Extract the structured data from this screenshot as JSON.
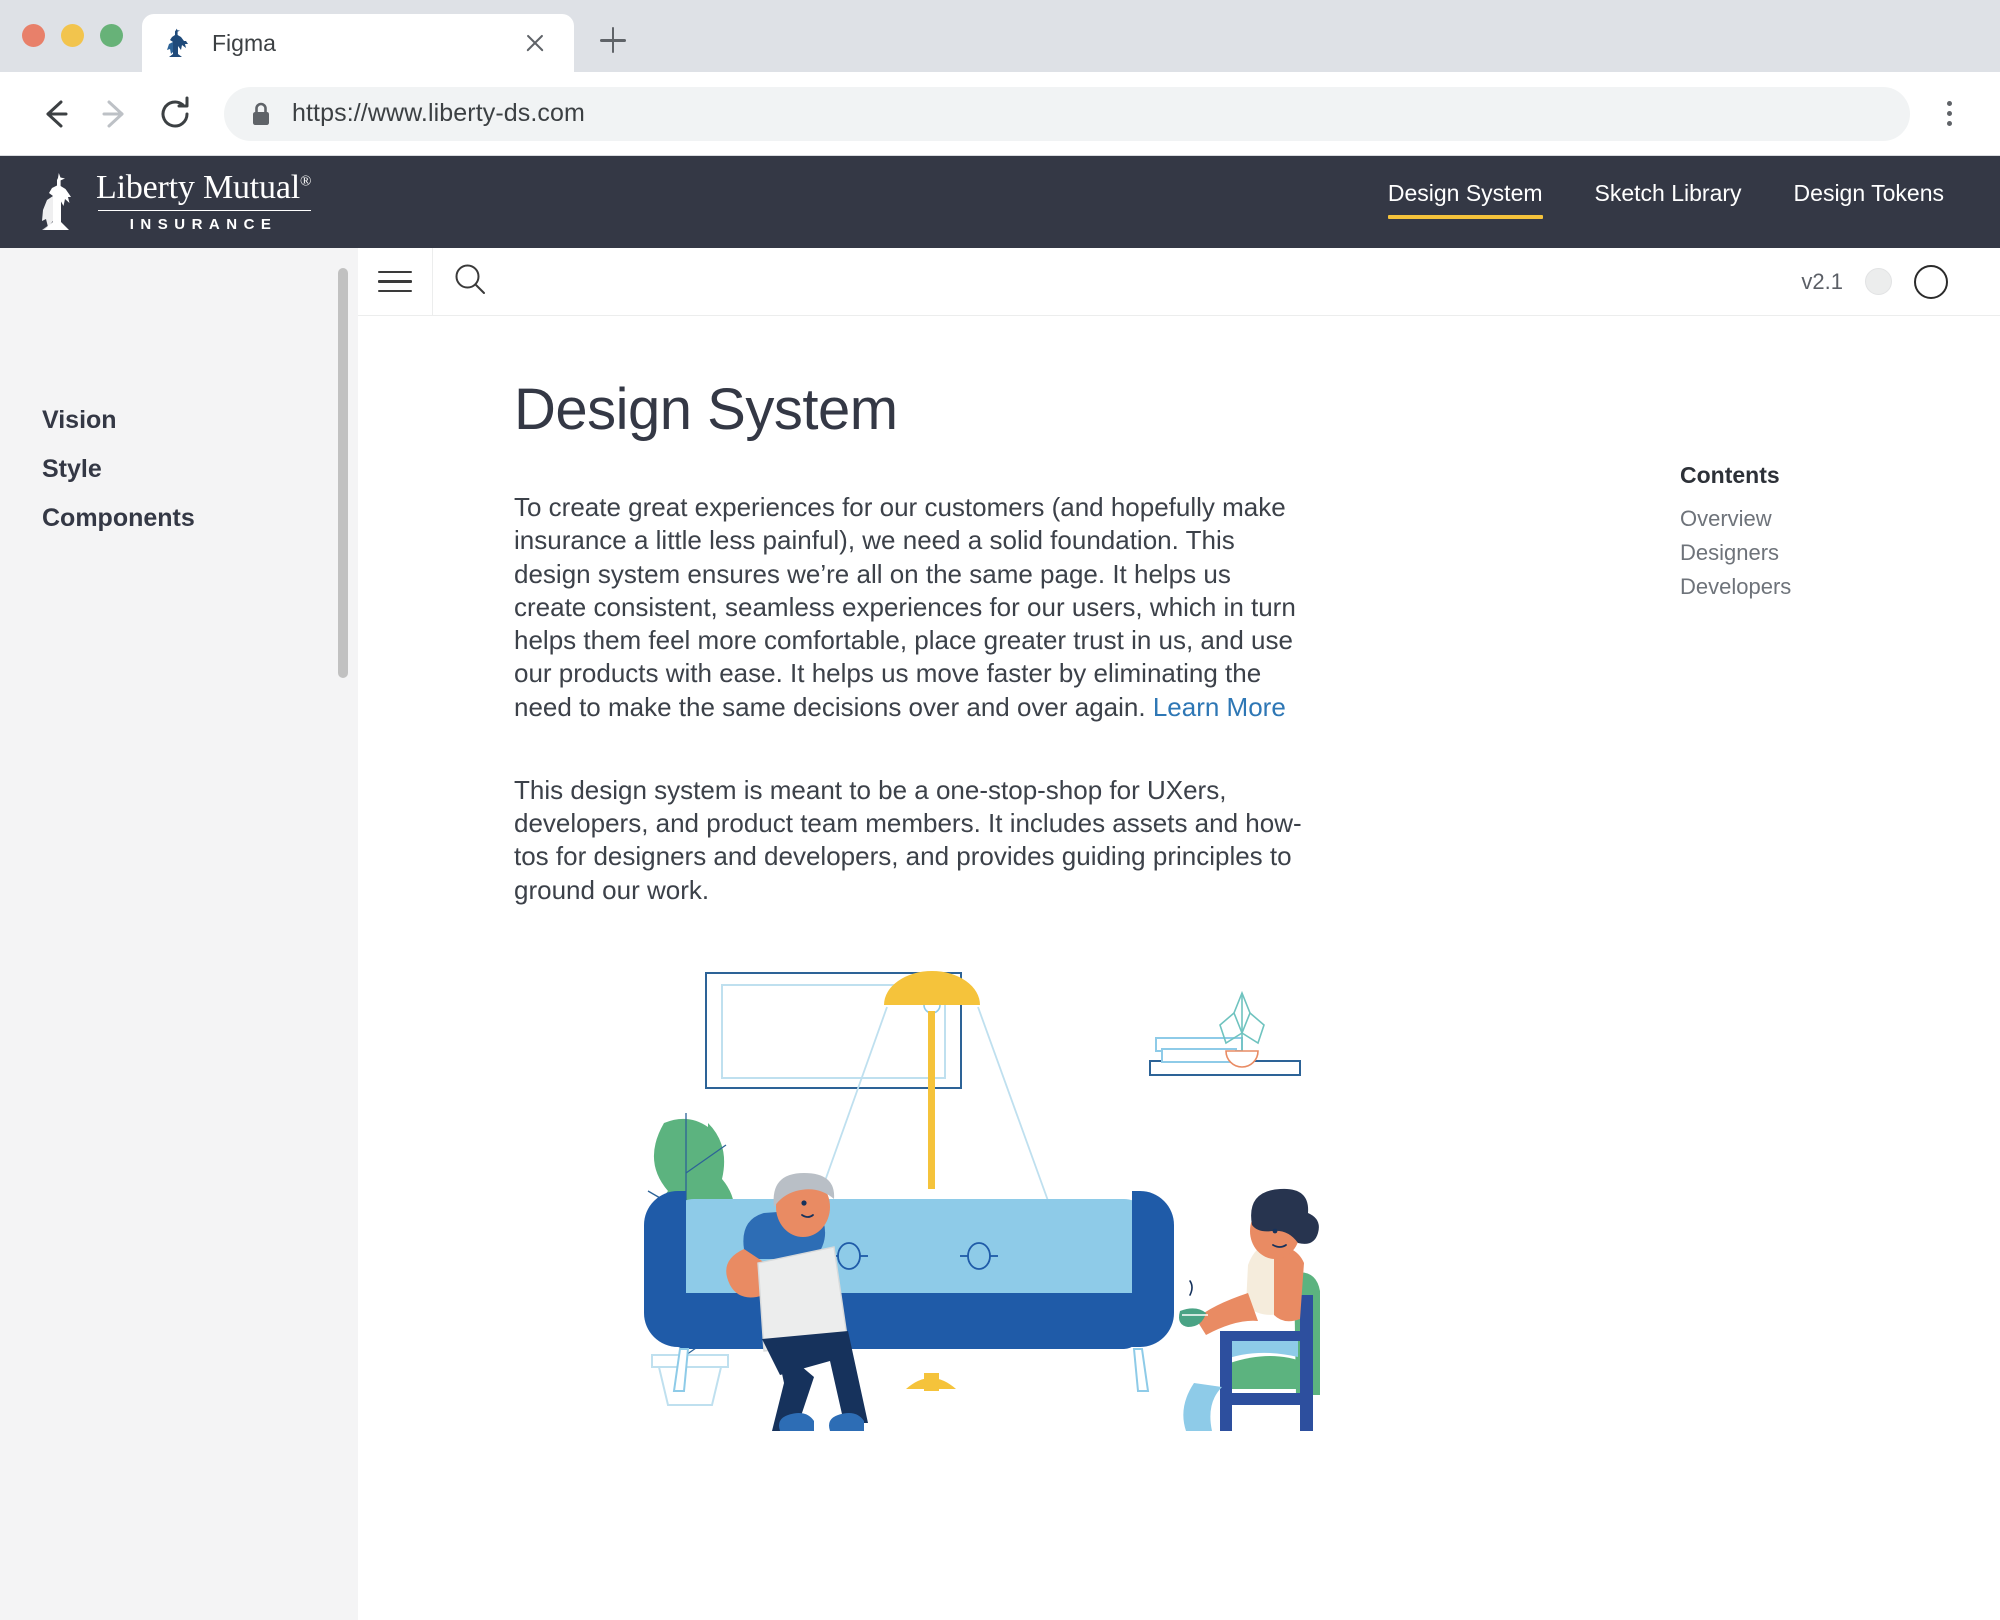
{
  "browser": {
    "tab": {
      "title": "Figma",
      "favicon_icon": "statue-of-liberty-icon",
      "close_icon": "close-icon"
    },
    "new_tab_icon": "plus-icon",
    "back_icon": "arrow-left-icon",
    "forward_icon": "arrow-right-icon",
    "reload_icon": "reload-icon",
    "lock_icon": "lock-icon",
    "url": "https://www.liberty-ds.com",
    "menu_icon": "kebab-menu-icon",
    "traffic_lights": [
      "close-window-button",
      "minimize-window-button",
      "maximize-window-button"
    ]
  },
  "site_header": {
    "logo": {
      "mark_icon": "statue-of-liberty-logo-icon",
      "wordmark": "Liberty Mutual",
      "registered": "®",
      "subtitle": "INSURANCE"
    },
    "nav": [
      {
        "label": "Design System",
        "active": true
      },
      {
        "label": "Sketch Library",
        "active": false
      },
      {
        "label": "Design Tokens",
        "active": false
      }
    ],
    "background_color": "#343845",
    "active_underline_color": "#f5c33b"
  },
  "sidebar": {
    "items": [
      {
        "label": "Vision"
      },
      {
        "label": "Style"
      },
      {
        "label": "Components"
      }
    ],
    "background_color": "#f4f4f5"
  },
  "toolbar": {
    "menu_icon": "hamburger-menu-icon",
    "search_icon": "search-icon",
    "version": "v2.1",
    "avatar_small_icon": "avatar-placeholder-icon",
    "avatar_large_icon": "avatar-outline-icon"
  },
  "main": {
    "title": "Design System",
    "paragraphs": [
      {
        "text": "To create great experiences for our customers (and hopefully make insurance a little less painful), we need a solid foundation. This design system ensures we’re all on the same page. It helps us create consistent, seamless experiences for our users, which in turn helps them feel more comfortable, place greater trust in us, and use our products with ease. It helps us move faster by eliminating the need to make the same decisions over and over again. ",
        "link": "Learn More"
      },
      {
        "text": "This design system is meant to be a one-stop-shop for UXers, developers, and product team members. It includes assets and how-tos for designers and developers, and provides guiding principles to ground our work.",
        "link": ""
      }
    ],
    "link_color": "#2e77b5"
  },
  "contents": {
    "title": "Contents",
    "links": [
      {
        "label": "Overview"
      },
      {
        "label": "Designers"
      },
      {
        "label": "Developers"
      }
    ]
  },
  "illustration": {
    "name": "living-room-people-illustration",
    "description": "Two people relaxing in a living room with a sofa, lamp, plants and shelf",
    "colors": {
      "sofa_light": "#8ecbe8",
      "sofa_dark": "#1f5ba8",
      "lamp_yellow": "#f5c33b",
      "plant_green": "#5cb37f",
      "skin": "#e98b63",
      "navy": "#16325c"
    }
  }
}
